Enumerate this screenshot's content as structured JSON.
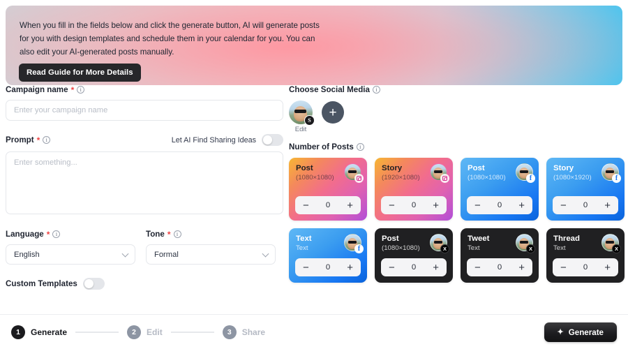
{
  "banner": {
    "text": "When you fill in the fields below and click the generate button, AI will generate posts for you with design templates and schedule them in your calendar for you. You can also edit your AI-generated posts manually.",
    "button_label": "Read Guide for More Details"
  },
  "form": {
    "campaign": {
      "label": "Campaign name",
      "required_mark": "*",
      "value": "",
      "placeholder": "Enter your campaign name"
    },
    "prompt": {
      "label": "Prompt",
      "required_mark": "*",
      "value": "",
      "placeholder": "Enter something...",
      "ai_toggle_label": "Let AI Find Sharing Ideas",
      "ai_toggle_on": false
    },
    "language": {
      "label": "Language",
      "required_mark": "*",
      "selected": "English"
    },
    "tone": {
      "label": "Tone",
      "required_mark": "*",
      "selected": "Formal"
    },
    "custom_templates": {
      "label": "Custom Templates",
      "on": false
    }
  },
  "social": {
    "label": "Choose Social Media",
    "accounts": [
      {
        "name": "connected-account",
        "badge": "S",
        "caption": "Edit"
      }
    ],
    "add_label": "+"
  },
  "posts": {
    "label": "Number of Posts",
    "cards": [
      {
        "title": "Post",
        "sub": "(1080×1080)",
        "network": "instagram",
        "badge": "ig",
        "count": "0",
        "minus": "−",
        "plus": "+"
      },
      {
        "title": "Story",
        "sub": "(1920×1080)",
        "network": "instagram",
        "badge": "ig",
        "count": "0",
        "minus": "−",
        "plus": "+"
      },
      {
        "title": "Post",
        "sub": "(1080×1080)",
        "network": "facebook",
        "badge": "fb",
        "count": "0",
        "minus": "−",
        "plus": "+"
      },
      {
        "title": "Story",
        "sub": "(1080×1920)",
        "network": "facebook",
        "badge": "fb",
        "count": "0",
        "minus": "−",
        "plus": "+"
      },
      {
        "title": "Text",
        "sub": "Text",
        "network": "facebook",
        "badge": "fb",
        "count": "0",
        "minus": "−",
        "plus": "+"
      },
      {
        "title": "Post",
        "sub": "(1080×1080)",
        "network": "x",
        "badge": "x",
        "count": "0",
        "minus": "−",
        "plus": "+"
      },
      {
        "title": "Tweet",
        "sub": "Text",
        "network": "x",
        "badge": "x",
        "count": "0",
        "minus": "−",
        "plus": "+"
      },
      {
        "title": "Thread",
        "sub": "Text",
        "network": "x",
        "badge": "x",
        "count": "0",
        "minus": "−",
        "plus": "+"
      }
    ]
  },
  "footer": {
    "steps": [
      {
        "number": "1",
        "label": "Generate",
        "active": true
      },
      {
        "number": "2",
        "label": "Edit",
        "active": false
      },
      {
        "number": "3",
        "label": "Share",
        "active": false
      }
    ],
    "generate_button": {
      "label": "Generate",
      "icon": "✦"
    }
  },
  "colors": {
    "accent_dark": "#1b1b1e",
    "required": "#ef4444",
    "instagram": "#e062b0",
    "facebook": "#1877f2",
    "x": "#202022"
  }
}
